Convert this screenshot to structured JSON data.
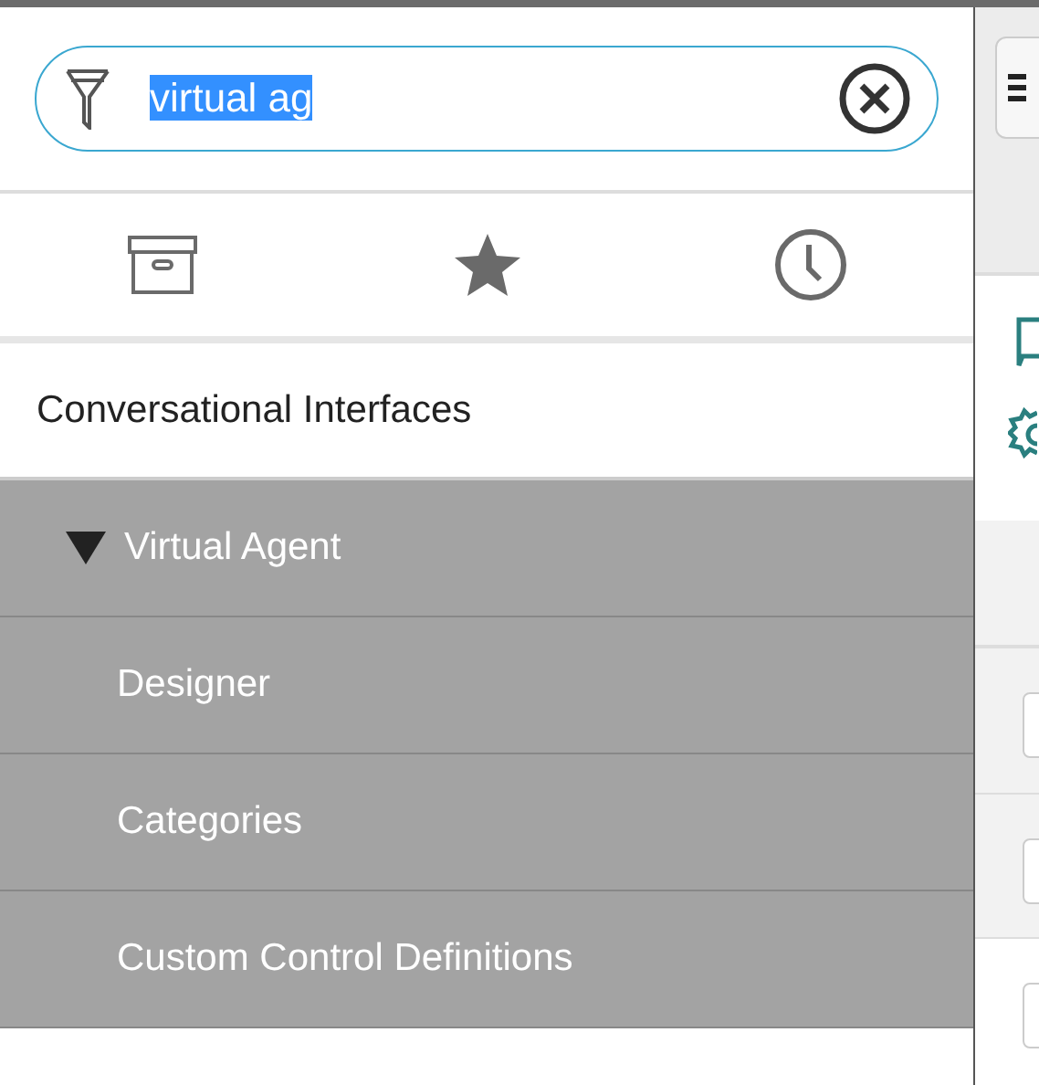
{
  "search": {
    "value": "virtual ag",
    "selected_text": true
  },
  "tabs": [
    {
      "kind": "archive"
    },
    {
      "kind": "star"
    },
    {
      "kind": "clock"
    }
  ],
  "tree": [
    {
      "label": "Conversational Interfaces",
      "highlighted": false,
      "children": [
        {
          "label": "Virtual Agent",
          "highlighted": true,
          "expanded": true,
          "children": [
            {
              "label": "Designer",
              "highlighted": true
            },
            {
              "label": "Categories",
              "highlighted": true
            },
            {
              "label": "Custom Control Definitions",
              "highlighted": true
            }
          ]
        }
      ]
    }
  ]
}
